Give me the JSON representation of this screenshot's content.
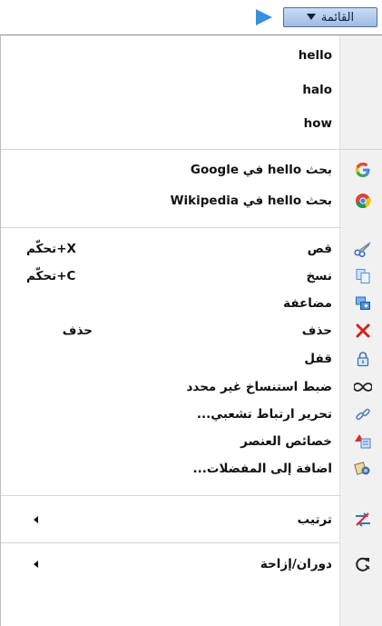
{
  "menu_button": {
    "label": "القائمة"
  },
  "suggestions": [
    "hello",
    "halo",
    "how"
  ],
  "search": [
    {
      "label": "بحث hello في Google",
      "icon": "google-icon"
    },
    {
      "label": "بحث hello في Wikipedia",
      "icon": "chrome-icon"
    }
  ],
  "edit": [
    {
      "label": "قص",
      "shortcut": "تحكّم+X",
      "icon": "scissors-icon"
    },
    {
      "label": "نسخ",
      "shortcut": "تحكّم+C",
      "icon": "copy-icon"
    },
    {
      "label": "مضاعفة",
      "shortcut": "",
      "icon": "duplicate-icon"
    },
    {
      "label": "حذف",
      "shortcut": "حذف",
      "icon": "delete-icon"
    },
    {
      "label": "قفل",
      "shortcut": "",
      "icon": "lock-icon"
    },
    {
      "label": "ضبط استنساخ غير محدد",
      "shortcut": "",
      "icon": "infinity-icon"
    },
    {
      "label": "تحرير ارتباط تشعبي...",
      "shortcut": "",
      "icon": "hyperlink-icon"
    },
    {
      "label": "خصائص العنصر",
      "shortcut": "",
      "icon": "properties-icon"
    },
    {
      "label": "اضافة إلى المفضلات...",
      "shortcut": "",
      "icon": "favorites-icon"
    }
  ],
  "arrange": {
    "label": "ترتيب",
    "icon": "arrange-icon"
  },
  "rotate": {
    "label": "دوران/إزاحة",
    "icon": "rotate-icon"
  }
}
